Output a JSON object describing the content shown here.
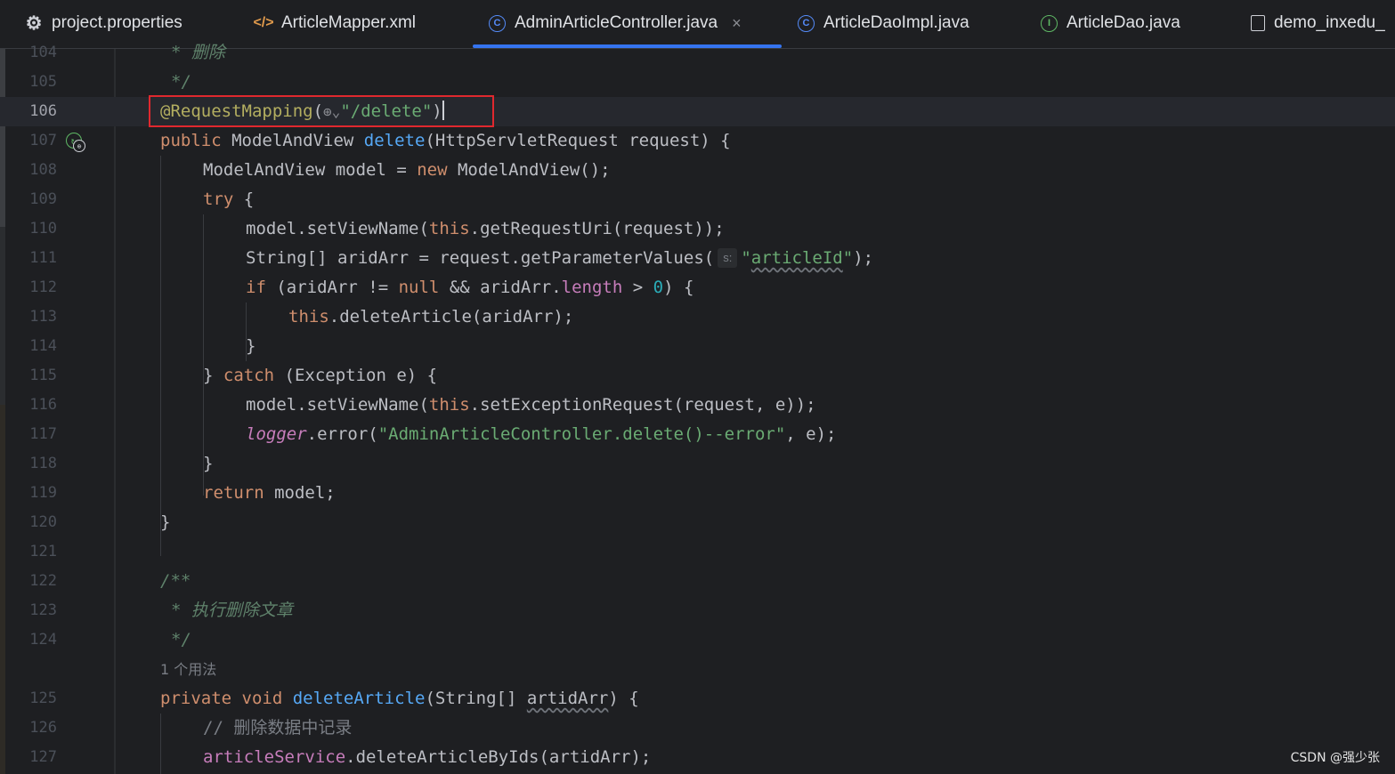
{
  "tabs": [
    {
      "label": "project.properties",
      "icon": "gear-icon",
      "active": false
    },
    {
      "label": "ArticleMapper.xml",
      "icon": "xml-icon",
      "active": false
    },
    {
      "label": "AdminArticleController.java",
      "icon": "class-icon",
      "active": true
    },
    {
      "label": "ArticleDaoImpl.java",
      "icon": "class-icon",
      "active": false
    },
    {
      "label": "ArticleDao.java",
      "icon": "interface-icon",
      "active": false
    },
    {
      "label": "demo_inxedu_",
      "icon": "file-icon",
      "active": false
    }
  ],
  "colors": {
    "accent": "#3574f0",
    "highlight_box": "#e0282e",
    "keyword": "#cf8e6d",
    "annotation": "#b3ae60",
    "method": "#56a8f5",
    "string": "#6aab73",
    "field": "#c77dbb",
    "number": "#2aacb8"
  },
  "editor": {
    "current_line": "106",
    "usage_hint": "1 个用法",
    "param_hint": "s:",
    "line_numbers": [
      "104",
      "105",
      "106",
      "107",
      "108",
      "109",
      "110",
      "111",
      "112",
      "113",
      "114",
      "115",
      "116",
      "117",
      "118",
      "119",
      "120",
      "121",
      "122",
      "123",
      "124",
      "125",
      "126",
      "127"
    ],
    "lines": {
      "l104": "* 删除",
      "l105": "*/",
      "l106_ann": "@RequestMapping",
      "l106_open": "(",
      "l106_str": "\"/delete\"",
      "l106_close": ")",
      "l107_kw": "public",
      "l107_type": " ModelAndView ",
      "l107_fn": "delete",
      "l107_rest": "(HttpServletRequest request) {",
      "l108_a": "ModelAndView model = ",
      "l108_kw": "new",
      "l108_b": " ModelAndView();",
      "l109_kw": "try",
      "l109_b": " {",
      "l110_a": "model.setViewName(",
      "l110_kw": "this",
      "l110_b": ".getRequestUri(request));",
      "l111_a": "String[] aridArr = request.getParameterValues(",
      "l111_str_q1": "\"",
      "l111_str": "articleId",
      "l111_str_q2": "\"",
      "l111_b": ");",
      "l112_kw": "if",
      "l112_a": " (aridArr != ",
      "l112_null": "null",
      "l112_b": " && aridArr.",
      "l112_fld": "length",
      "l112_c": " > ",
      "l112_num": "0",
      "l112_d": ") {",
      "l113_kw": "this",
      "l113_b": ".deleteArticle(aridArr);",
      "l114": "}",
      "l115_a": "} ",
      "l115_kw": "catch",
      "l115_b": " (Exception e) {",
      "l116_a": "model.setViewName(",
      "l116_kw": "this",
      "l116_b": ".setExceptionRequest(request, e));",
      "l117_fld": "logger",
      "l117_a": ".error(",
      "l117_str": "\"AdminArticleController.delete()--error\"",
      "l117_b": ", e);",
      "l118": "}",
      "l119_kw": "return",
      "l119_b": " model;",
      "l120": "}",
      "l122": "/**",
      "l123": "* 执行删除文章",
      "l124": "*/",
      "l125_kw": "private void",
      "l125_sp": " ",
      "l125_fn": "deleteArticle",
      "l125_a": "(String[] ",
      "l125_sq": "artidArr",
      "l125_b": ") {",
      "l126": "// 删除数据中记录",
      "l127_fld": "articleService",
      "l127_b": ".deleteArticleByIds(artidArr);"
    }
  },
  "watermark": "CSDN @强少张"
}
